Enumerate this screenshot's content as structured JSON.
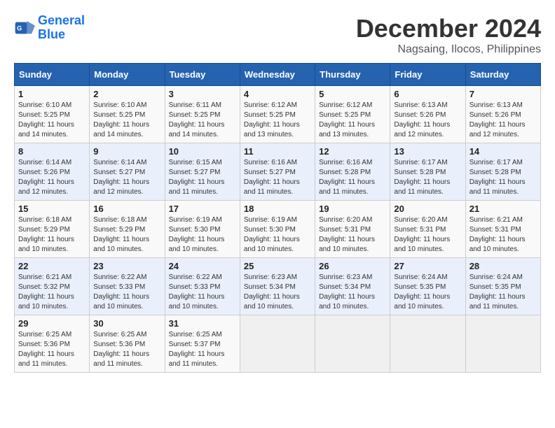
{
  "header": {
    "logo_line1": "General",
    "logo_line2": "Blue",
    "month": "December 2024",
    "location": "Nagsaing, Ilocos, Philippines"
  },
  "weekdays": [
    "Sunday",
    "Monday",
    "Tuesday",
    "Wednesday",
    "Thursday",
    "Friday",
    "Saturday"
  ],
  "weeks": [
    [
      {
        "day": 1,
        "sunrise": "6:10 AM",
        "sunset": "5:25 PM",
        "daylight": "11 hours and 14 minutes."
      },
      {
        "day": 2,
        "sunrise": "6:10 AM",
        "sunset": "5:25 PM",
        "daylight": "11 hours and 14 minutes."
      },
      {
        "day": 3,
        "sunrise": "6:11 AM",
        "sunset": "5:25 PM",
        "daylight": "11 hours and 14 minutes."
      },
      {
        "day": 4,
        "sunrise": "6:12 AM",
        "sunset": "5:25 PM",
        "daylight": "11 hours and 13 minutes."
      },
      {
        "day": 5,
        "sunrise": "6:12 AM",
        "sunset": "5:25 PM",
        "daylight": "11 hours and 13 minutes."
      },
      {
        "day": 6,
        "sunrise": "6:13 AM",
        "sunset": "5:26 PM",
        "daylight": "11 hours and 12 minutes."
      },
      {
        "day": 7,
        "sunrise": "6:13 AM",
        "sunset": "5:26 PM",
        "daylight": "11 hours and 12 minutes."
      }
    ],
    [
      {
        "day": 8,
        "sunrise": "6:14 AM",
        "sunset": "5:26 PM",
        "daylight": "11 hours and 12 minutes."
      },
      {
        "day": 9,
        "sunrise": "6:14 AM",
        "sunset": "5:27 PM",
        "daylight": "11 hours and 12 minutes."
      },
      {
        "day": 10,
        "sunrise": "6:15 AM",
        "sunset": "5:27 PM",
        "daylight": "11 hours and 11 minutes."
      },
      {
        "day": 11,
        "sunrise": "6:16 AM",
        "sunset": "5:27 PM",
        "daylight": "11 hours and 11 minutes."
      },
      {
        "day": 12,
        "sunrise": "6:16 AM",
        "sunset": "5:28 PM",
        "daylight": "11 hours and 11 minutes."
      },
      {
        "day": 13,
        "sunrise": "6:17 AM",
        "sunset": "5:28 PM",
        "daylight": "11 hours and 11 minutes."
      },
      {
        "day": 14,
        "sunrise": "6:17 AM",
        "sunset": "5:28 PM",
        "daylight": "11 hours and 11 minutes."
      }
    ],
    [
      {
        "day": 15,
        "sunrise": "6:18 AM",
        "sunset": "5:29 PM",
        "daylight": "11 hours and 10 minutes."
      },
      {
        "day": 16,
        "sunrise": "6:18 AM",
        "sunset": "5:29 PM",
        "daylight": "11 hours and 10 minutes."
      },
      {
        "day": 17,
        "sunrise": "6:19 AM",
        "sunset": "5:30 PM",
        "daylight": "11 hours and 10 minutes."
      },
      {
        "day": 18,
        "sunrise": "6:19 AM",
        "sunset": "5:30 PM",
        "daylight": "11 hours and 10 minutes."
      },
      {
        "day": 19,
        "sunrise": "6:20 AM",
        "sunset": "5:31 PM",
        "daylight": "11 hours and 10 minutes."
      },
      {
        "day": 20,
        "sunrise": "6:20 AM",
        "sunset": "5:31 PM",
        "daylight": "11 hours and 10 minutes."
      },
      {
        "day": 21,
        "sunrise": "6:21 AM",
        "sunset": "5:31 PM",
        "daylight": "11 hours and 10 minutes."
      }
    ],
    [
      {
        "day": 22,
        "sunrise": "6:21 AM",
        "sunset": "5:32 PM",
        "daylight": "11 hours and 10 minutes."
      },
      {
        "day": 23,
        "sunrise": "6:22 AM",
        "sunset": "5:33 PM",
        "daylight": "11 hours and 10 minutes."
      },
      {
        "day": 24,
        "sunrise": "6:22 AM",
        "sunset": "5:33 PM",
        "daylight": "11 hours and 10 minutes."
      },
      {
        "day": 25,
        "sunrise": "6:23 AM",
        "sunset": "5:34 PM",
        "daylight": "11 hours and 10 minutes."
      },
      {
        "day": 26,
        "sunrise": "6:23 AM",
        "sunset": "5:34 PM",
        "daylight": "11 hours and 10 minutes."
      },
      {
        "day": 27,
        "sunrise": "6:24 AM",
        "sunset": "5:35 PM",
        "daylight": "11 hours and 10 minutes."
      },
      {
        "day": 28,
        "sunrise": "6:24 AM",
        "sunset": "5:35 PM",
        "daylight": "11 hours and 11 minutes."
      }
    ],
    [
      {
        "day": 29,
        "sunrise": "6:25 AM",
        "sunset": "5:36 PM",
        "daylight": "11 hours and 11 minutes."
      },
      {
        "day": 30,
        "sunrise": "6:25 AM",
        "sunset": "5:36 PM",
        "daylight": "11 hours and 11 minutes."
      },
      {
        "day": 31,
        "sunrise": "6:25 AM",
        "sunset": "5:37 PM",
        "daylight": "11 hours and 11 minutes."
      },
      null,
      null,
      null,
      null
    ]
  ],
  "labels": {
    "sunrise": "Sunrise:",
    "sunset": "Sunset:",
    "daylight": "Daylight:"
  }
}
